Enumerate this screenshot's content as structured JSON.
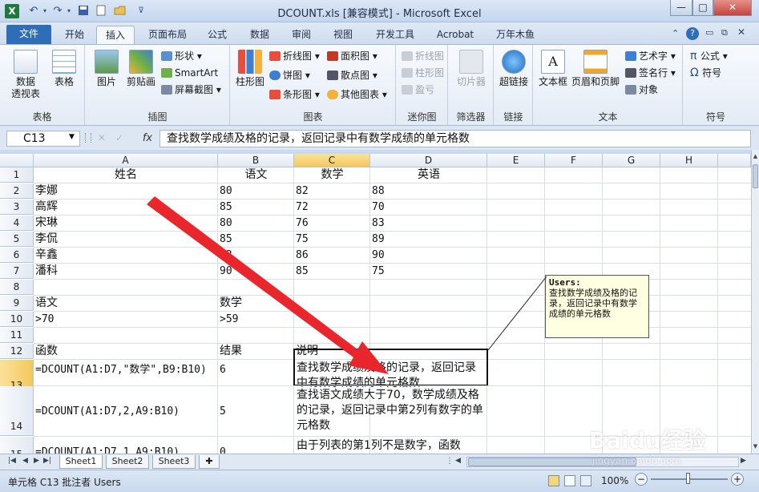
{
  "window": {
    "title": "DCOUNT.xls  [兼容模式] - Microsoft Excel",
    "app_icon": "excel-icon",
    "quick_access": [
      "undo-icon",
      "redo-icon",
      "save-icon",
      "new-icon",
      "open-icon",
      "customize-icon"
    ]
  },
  "tabs": {
    "file": "文件",
    "items": [
      "开始",
      "插入",
      "页面布局",
      "公式",
      "数据",
      "审阅",
      "视图",
      "开发工具",
      "Acrobat",
      "万年木鱼"
    ],
    "active": "插入"
  },
  "ribbon": {
    "groups": {
      "tables": {
        "label": "表格",
        "pivot": "数据\n透视表",
        "pivot_l1": "数据",
        "pivot_l2": "透视表",
        "table": "表格"
      },
      "illustrations": {
        "label": "插图",
        "picture": "图片",
        "clipart": "剪贴画",
        "shapes": "形状",
        "smartart": "SmartArt",
        "screenshot": "屏幕截图"
      },
      "charts": {
        "label": "图表",
        "column": "柱形图",
        "line": "折线图",
        "pie": "饼图",
        "bar": "条形图",
        "area": "面积图",
        "scatter": "散点图",
        "other": "其他图表"
      },
      "sparklines": {
        "label": "迷你图",
        "line": "折线图",
        "column": "柱形图",
        "winloss": "盈亏"
      },
      "filter": {
        "label": "筛选器",
        "slicer": "切片器"
      },
      "links": {
        "label": "链接",
        "hyperlink": "超链接"
      },
      "text": {
        "label": "文本",
        "textbox": "文本框",
        "headerfooter": "页眉和页脚",
        "wordart": "艺术字",
        "signature": "签名行",
        "object": "对象"
      },
      "symbols": {
        "label": "符号",
        "equation": "公式",
        "symbol": "符号"
      }
    }
  },
  "formula_bar": {
    "name_box": "C13",
    "fx": "fx",
    "content": "查找数学成绩及格的记录，返回记录中有数学成绩的单元格数"
  },
  "grid": {
    "columns": [
      "A",
      "B",
      "C",
      "D",
      "E",
      "F",
      "G",
      "H"
    ],
    "selected_column": "C",
    "selected_row": "13",
    "rows": [
      {
        "num": "1",
        "a": "姓名",
        "b": "语文",
        "c": "数学",
        "d": "英语"
      },
      {
        "num": "2",
        "a": "李娜",
        "b": "80",
        "c": "82",
        "d": "88"
      },
      {
        "num": "3",
        "a": "高辉",
        "b": "85",
        "c": "72",
        "d": "70"
      },
      {
        "num": "4",
        "a": "宋琳",
        "b": "80",
        "c": "76",
        "d": "83"
      },
      {
        "num": "5",
        "a": "李侃",
        "b": "85",
        "c": "75",
        "d": "89"
      },
      {
        "num": "6",
        "a": "辛鑫",
        "b": "72",
        "c": "86",
        "d": "90"
      },
      {
        "num": "7",
        "a": "潘科",
        "b": "90",
        "c": "85",
        "d": "75"
      },
      {
        "num": "8",
        "a": "",
        "b": "",
        "c": "",
        "d": ""
      },
      {
        "num": "9",
        "a": "语文",
        "b": "数学",
        "c": "",
        "d": ""
      },
      {
        "num": "10",
        "a": ">70",
        "b": ">59",
        "c": "",
        "d": ""
      },
      {
        "num": "11",
        "a": "",
        "b": "",
        "c": "",
        "d": ""
      },
      {
        "num": "12",
        "a": "函数",
        "b": "结果",
        "c": "说明",
        "d": ""
      },
      {
        "num": "13",
        "a": "=DCOUNT(A1:D7,\"数学\",B9:B10)",
        "b": "6",
        "c": "查找数学成绩及格的记录，返回记录中有数学成绩的单元格数",
        "d": ""
      },
      {
        "num": "14",
        "a": "=DCOUNT(A1:D7,2,A9:B10)",
        "b": "5",
        "c": "查找语文成绩大于70，数学成绩及格的记录，返回记录中第2列有数字的单元格数",
        "d": ""
      },
      {
        "num": "15",
        "a": "=DCOUNT(A1:D7,1,A9:B10)",
        "b": "0",
        "c": "由于列表的第1列不是数字，函数",
        "d": ""
      }
    ]
  },
  "comment": {
    "author": "Users:",
    "text": "查找数学成绩及格的记录，返回记录中有数学成绩的单元格数"
  },
  "sheets": {
    "tabs": [
      "Sheet1",
      "Sheet2",
      "Sheet3"
    ],
    "active": "Sheet1"
  },
  "status": {
    "text": "单元格 C13 批注者 Users",
    "zoom": "100%"
  },
  "watermark": {
    "logo": "Baidu经验",
    "url": "jingyan.baidu.com"
  },
  "colors": {
    "accent": "#2f6db8",
    "selection": "#f3c85a",
    "arrow": "#e8262b",
    "excel_green": "#1e7a3a"
  }
}
